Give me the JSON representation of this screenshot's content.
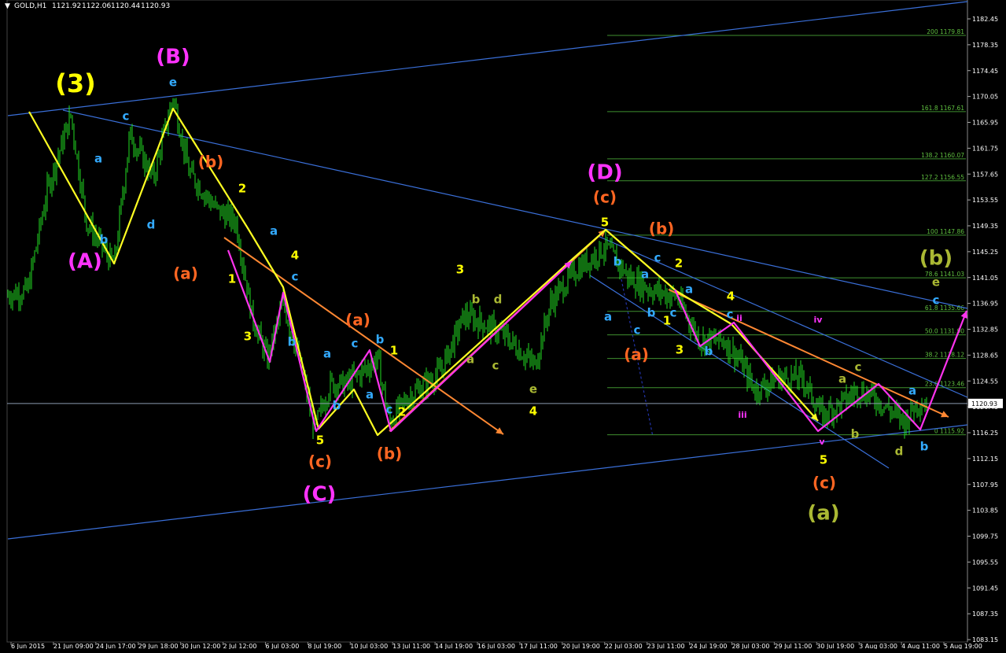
{
  "chart_data": {
    "type": "candlestick",
    "title": "GOLD,H1",
    "header_values": [
      "1121.92",
      "1122.06",
      "1120.44",
      "1120.93"
    ],
    "y_ticks": [
      "1182.45",
      "1178.35",
      "1174.45",
      "1170.05",
      "1165.95",
      "1161.75",
      "1157.65",
      "1153.55",
      "1149.35",
      "1145.25",
      "1141.05",
      "1136.95",
      "1132.85",
      "1128.65",
      "1124.55",
      "1120.45",
      "1116.25",
      "1112.15",
      "1107.95",
      "1103.85",
      "1099.75",
      "1095.55",
      "1091.45",
      "1087.35",
      "1083.15"
    ],
    "ylim": [
      1082,
      1185
    ],
    "current_price": "1120.93",
    "fib_levels": [
      {
        "label": "200 1179.81",
        "price": 1179.81
      },
      {
        "label": "161.8 1167.61",
        "price": 1167.61
      },
      {
        "label": "138.2 1160.07",
        "price": 1160.07
      },
      {
        "label": "127.2 1156.55",
        "price": 1156.55
      },
      {
        "label": "100 1147.86",
        "price": 1147.86
      },
      {
        "label": "78.6 1141.03",
        "price": 1141.03
      },
      {
        "label": "61.8 1135.66",
        "price": 1135.66
      },
      {
        "label": "50.0 1131.90",
        "price": 1131.9
      },
      {
        "label": "38.2 1128.12",
        "price": 1128.12
      },
      {
        "label": "23.6 1123.46",
        "price": 1123.46
      },
      {
        "label": "0 1115.92",
        "price": 1115.92
      }
    ],
    "price_path": [
      [
        0,
        1138
      ],
      [
        35,
        1139
      ],
      [
        60,
        1155
      ],
      [
        90,
        1167
      ],
      [
        110,
        1150
      ],
      [
        145,
        1143
      ],
      [
        165,
        1164
      ],
      [
        195,
        1157
      ],
      [
        220,
        1170
      ],
      [
        240,
        1158
      ],
      [
        275,
        1152
      ],
      [
        300,
        1150
      ],
      [
        320,
        1135
      ],
      [
        340,
        1128
      ],
      [
        360,
        1137
      ],
      [
        380,
        1128
      ],
      [
        400,
        1117
      ],
      [
        420,
        1124
      ],
      [
        440,
        1124
      ],
      [
        460,
        1126
      ],
      [
        480,
        1128
      ],
      [
        495,
        1118
      ],
      [
        520,
        1122
      ],
      [
        560,
        1126
      ],
      [
        590,
        1135
      ],
      [
        610,
        1134
      ],
      [
        640,
        1132
      ],
      [
        680,
        1127
      ],
      [
        700,
        1137
      ],
      [
        730,
        1142
      ],
      [
        770,
        1146
      ],
      [
        800,
        1141
      ],
      [
        830,
        1139
      ],
      [
        860,
        1138
      ],
      [
        890,
        1131
      ],
      [
        920,
        1131
      ],
      [
        940,
        1128
      ],
      [
        960,
        1123
      ],
      [
        990,
        1125
      ],
      [
        1020,
        1125
      ],
      [
        1045,
        1119
      ],
      [
        1070,
        1121
      ],
      [
        1090,
        1123
      ],
      [
        1110,
        1122
      ],
      [
        1130,
        1120
      ],
      [
        1150,
        1118
      ],
      [
        1165,
        1121
      ],
      [
        1180,
        1121
      ]
    ],
    "wave_labels": [
      {
        "text": "(3)",
        "x": 96,
        "y": 108,
        "color": "#ffff00",
        "size": 32
      },
      {
        "text": "(B)",
        "x": 220,
        "y": 73,
        "color": "#ff33ff",
        "size": 26
      },
      {
        "text": "e",
        "x": 220,
        "y": 105,
        "color": "#33aaff",
        "size": 15
      },
      {
        "text": "c",
        "x": 160,
        "y": 148,
        "color": "#33aaff",
        "size": 15
      },
      {
        "text": "a",
        "x": 125,
        "y": 202,
        "color": "#33aaff",
        "size": 15
      },
      {
        "text": "b",
        "x": 132,
        "y": 305,
        "color": "#33aaff",
        "size": 15
      },
      {
        "text": "d",
        "x": 192,
        "y": 286,
        "color": "#33aaff",
        "size": 15
      },
      {
        "text": "(A)",
        "x": 108,
        "y": 333,
        "color": "#ff33ff",
        "size": 26
      },
      {
        "text": "(b)",
        "x": 268,
        "y": 207,
        "color": "#ff6622",
        "size": 20
      },
      {
        "text": "2",
        "x": 308,
        "y": 240,
        "color": "#ffff00",
        "size": 15
      },
      {
        "text": "(a)",
        "x": 236,
        "y": 349,
        "color": "#ff6622",
        "size": 20
      },
      {
        "text": "a",
        "x": 348,
        "y": 294,
        "color": "#33aaff",
        "size": 15
      },
      {
        "text": "4",
        "x": 375,
        "y": 325,
        "color": "#ffff00",
        "size": 15
      },
      {
        "text": "c",
        "x": 375,
        "y": 352,
        "color": "#33aaff",
        "size": 15
      },
      {
        "text": "1",
        "x": 295,
        "y": 355,
        "color": "#ffff00",
        "size": 15
      },
      {
        "text": "3",
        "x": 315,
        "y": 428,
        "color": "#ffff00",
        "size": 15
      },
      {
        "text": "b",
        "x": 371,
        "y": 435,
        "color": "#33aaff",
        "size": 15
      },
      {
        "text": "a",
        "x": 416,
        "y": 450,
        "color": "#33aaff",
        "size": 15
      },
      {
        "text": "b",
        "x": 428,
        "y": 516,
        "color": "#33aaff",
        "size": 15
      },
      {
        "text": "5",
        "x": 407,
        "y": 560,
        "color": "#ffff00",
        "size": 15
      },
      {
        "text": "(c)",
        "x": 407,
        "y": 588,
        "color": "#ff6622",
        "size": 20
      },
      {
        "text": "(C)",
        "x": 406,
        "y": 629,
        "color": "#ff33ff",
        "size": 26
      },
      {
        "text": "(a)",
        "x": 455,
        "y": 408,
        "color": "#ff6622",
        "size": 20
      },
      {
        "text": "c",
        "x": 451,
        "y": 437,
        "color": "#33aaff",
        "size": 15
      },
      {
        "text": "b",
        "x": 483,
        "y": 432,
        "color": "#33aaff",
        "size": 15
      },
      {
        "text": "1",
        "x": 501,
        "y": 446,
        "color": "#ffff00",
        "size": 15
      },
      {
        "text": "a",
        "x": 470,
        "y": 502,
        "color": "#33aaff",
        "size": 15
      },
      {
        "text": "2",
        "x": 511,
        "y": 524,
        "color": "#ffff00",
        "size": 15
      },
      {
        "text": "c",
        "x": 495,
        "y": 521,
        "color": "#33aaff",
        "size": 15
      },
      {
        "text": "(b)",
        "x": 495,
        "y": 578,
        "color": "#ff6622",
        "size": 20
      },
      {
        "text": "3",
        "x": 585,
        "y": 343,
        "color": "#ffff00",
        "size": 15
      },
      {
        "text": "b",
        "x": 605,
        "y": 381,
        "color": "#aab833",
        "size": 15
      },
      {
        "text": "d",
        "x": 633,
        "y": 381,
        "color": "#aab833",
        "size": 15
      },
      {
        "text": "a",
        "x": 598,
        "y": 457,
        "color": "#aab833",
        "size": 15
      },
      {
        "text": "c",
        "x": 630,
        "y": 465,
        "color": "#aab833",
        "size": 15
      },
      {
        "text": "e",
        "x": 678,
        "y": 495,
        "color": "#aab833",
        "size": 15
      },
      {
        "text": "4",
        "x": 678,
        "y": 523,
        "color": "#ffff00",
        "size": 15
      },
      {
        "text": "(D)",
        "x": 769,
        "y": 220,
        "color": "#ff33ff",
        "size": 26
      },
      {
        "text": "(c)",
        "x": 769,
        "y": 252,
        "color": "#ff6622",
        "size": 20
      },
      {
        "text": "5",
        "x": 769,
        "y": 283,
        "color": "#ffff00",
        "size": 15
      },
      {
        "text": "(b)",
        "x": 841,
        "y": 292,
        "color": "#ff6622",
        "size": 20
      },
      {
        "text": "b",
        "x": 785,
        "y": 333,
        "color": "#33aaff",
        "size": 15
      },
      {
        "text": "c",
        "x": 836,
        "y": 328,
        "color": "#33aaff",
        "size": 15
      },
      {
        "text": "2",
        "x": 863,
        "y": 335,
        "color": "#ffff00",
        "size": 15
      },
      {
        "text": "a",
        "x": 820,
        "y": 349,
        "color": "#33aaff",
        "size": 15
      },
      {
        "text": "a",
        "x": 876,
        "y": 368,
        "color": "#33aaff",
        "size": 15
      },
      {
        "text": "4",
        "x": 929,
        "y": 377,
        "color": "#ffff00",
        "size": 15
      },
      {
        "text": "a",
        "x": 773,
        "y": 403,
        "color": "#33aaff",
        "size": 15
      },
      {
        "text": "b",
        "x": 828,
        "y": 398,
        "color": "#33aaff",
        "size": 15
      },
      {
        "text": "c",
        "x": 856,
        "y": 398,
        "color": "#33aaff",
        "size": 15
      },
      {
        "text": "1",
        "x": 848,
        "y": 408,
        "color": "#ffff00",
        "size": 15
      },
      {
        "text": "c",
        "x": 928,
        "y": 400,
        "color": "#33aaff",
        "size": 15
      },
      {
        "text": "c",
        "x": 810,
        "y": 420,
        "color": "#33aaff",
        "size": 15
      },
      {
        "text": "ii",
        "x": 940,
        "y": 405,
        "color": "#ff33ff",
        "size": 11
      },
      {
        "text": "(a)",
        "x": 809,
        "y": 452,
        "color": "#ff6622",
        "size": 20
      },
      {
        "text": "3",
        "x": 864,
        "y": 445,
        "color": "#ffff00",
        "size": 15
      },
      {
        "text": "b",
        "x": 901,
        "y": 447,
        "color": "#33aaff",
        "size": 15
      },
      {
        "text": "iii",
        "x": 944,
        "y": 528,
        "color": "#ff33ff",
        "size": 11
      },
      {
        "text": "iv",
        "x": 1040,
        "y": 407,
        "color": "#ff33ff",
        "size": 11
      },
      {
        "text": "c",
        "x": 1091,
        "y": 467,
        "color": "#aab833",
        "size": 15
      },
      {
        "text": "a",
        "x": 1071,
        "y": 482,
        "color": "#aab833",
        "size": 15
      },
      {
        "text": "a",
        "x": 1160,
        "y": 497,
        "color": "#33aaff",
        "size": 15
      },
      {
        "text": "b",
        "x": 1087,
        "y": 552,
        "color": "#aab833",
        "size": 15
      },
      {
        "text": "v",
        "x": 1045,
        "y": 562,
        "color": "#ff33ff",
        "size": 11
      },
      {
        "text": "5",
        "x": 1047,
        "y": 585,
        "color": "#ffff00",
        "size": 15
      },
      {
        "text": "d",
        "x": 1143,
        "y": 574,
        "color": "#aab833",
        "size": 15
      },
      {
        "text": "b",
        "x": 1175,
        "y": 568,
        "color": "#33aaff",
        "size": 15
      },
      {
        "text": "(c)",
        "x": 1048,
        "y": 615,
        "color": "#ff6622",
        "size": 20
      },
      {
        "text": "(a)",
        "x": 1047,
        "y": 653,
        "color": "#aab833",
        "size": 26
      },
      {
        "text": "(b)",
        "x": 1190,
        "y": 329,
        "color": "#aab833",
        "size": 26
      },
      {
        "text": "e",
        "x": 1190,
        "y": 359,
        "color": "#aab833",
        "size": 15
      },
      {
        "text": "c",
        "x": 1190,
        "y": 382,
        "color": "#33aaff",
        "size": 15
      }
    ],
    "yellow_lines": [
      [
        [
          37,
          142
        ],
        [
          145,
          335
        ],
        [
          220,
          138
        ],
        [
          315,
          290
        ],
        [
          360,
          365
        ],
        [
          405,
          545
        ],
        [
          450,
          495
        ],
        [
          480,
          553
        ],
        [
          727,
          330
        ],
        [
          770,
          292
        ],
        [
          860,
          370
        ],
        [
          930,
          412
        ],
        [
          1040,
          535
        ]
      ]
    ],
    "magenta_lines": [
      [
        [
          290,
          318
        ],
        [
          343,
          460
        ],
        [
          360,
          372
        ],
        [
          402,
          548
        ],
        [
          470,
          445
        ],
        [
          497,
          548
        ],
        [
          727,
          332
        ]
      ],
      [
        [
          858,
          368
        ],
        [
          890,
          440
        ],
        [
          933,
          410
        ],
        [
          1040,
          548
        ],
        [
          1117,
          488
        ],
        [
          1170,
          546
        ],
        [
          1229,
          395
        ]
      ]
    ],
    "orange_lines": [
      [
        [
          495,
          548
        ],
        [
          770,
          292
        ]
      ],
      [
        [
          285,
          302
        ],
        [
          640,
          552
        ]
      ],
      [
        [
          850,
          368
        ],
        [
          1206,
          530
        ]
      ]
    ],
    "blue_lines": [
      [
        [
          10,
          147
        ],
        [
          1230,
          2
        ]
      ],
      [
        [
          10,
          685
        ],
        [
          1230,
          540
        ]
      ],
      [
        [
          80,
          140
        ],
        [
          1230,
          392
        ]
      ],
      [
        [
          760,
          300
        ],
        [
          1230,
          505
        ]
      ],
      [
        [
          750,
          350
        ],
        [
          1130,
          595
        ]
      ]
    ],
    "x_axis_labels": [
      "6 Jun 2015",
      "21 Jun 09:00",
      "24 Jun 17:00",
      "29 Jun 18:00",
      "30 Jun 12:00",
      "2 Jul 12:00",
      "6 Jul 03:00",
      "8 Jul 19:00",
      "10 Jul 03:00",
      "13 Jul 11:00",
      "14 Jul 19:00",
      "16 Jul 03:00",
      "17 Jul 11:00",
      "20 Jul 19:00",
      "22 Jul 03:00",
      "23 Jul 11:00",
      "24 Jul 19:00",
      "28 Jul 03:00",
      "29 Jul 11:00",
      "30 Jul 19:00",
      "3 Aug 03:00",
      "4 Aug 11:00",
      "5 Aug 19:00"
    ]
  }
}
